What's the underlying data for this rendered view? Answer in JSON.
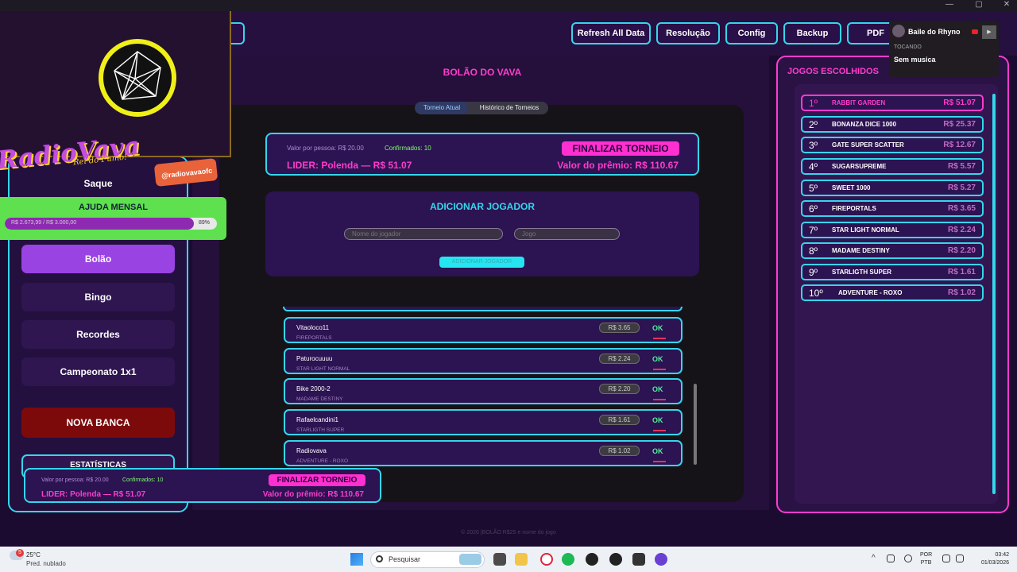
{
  "window_controls": [
    "—",
    "▢",
    "✕"
  ],
  "header": {
    "buttons": [
      "Refresh All Data",
      "Resolução",
      "Config",
      "Backup",
      "PDF"
    ]
  },
  "main": {
    "title": "BOLÃO DO VAVA",
    "tabs": [
      "Torneio Atual",
      "Histórico de Torneios"
    ],
    "summary": {
      "per_person": "Valor por pessoa: R$ 20.00",
      "confirmed": "Confirmados: 10",
      "finalize_label": "FINALIZAR TORNEIO",
      "leader": "LIDER: Polenda — R$ 51.07",
      "prize": "Valor do prêmio: R$ 110.67"
    },
    "add_player": {
      "title": "ADICIONAR JOGADOR",
      "name_placeholder": "Nome do jogador",
      "game_placeholder": "Jogo",
      "button_label": "ADICIONAR JOGADOR"
    },
    "players": [
      {
        "name": "Vitaoloco11",
        "game": "FIREPORTALS",
        "value": "R$ 3.65",
        "status": "OK"
      },
      {
        "name": "Paturocuuuu",
        "game": "STAR LIGHT NORMAL",
        "value": "R$ 2.24",
        "status": "OK"
      },
      {
        "name": "Bike 2000-2",
        "game": "MADAME DESTINY",
        "value": "R$ 2.20",
        "status": "OK"
      },
      {
        "name": "Rafaelcandini1",
        "game": "STARLIGTH SUPER",
        "value": "R$ 1.61",
        "status": "OK"
      },
      {
        "name": "Radiovava",
        "game": "ADVENTURE - ROXO",
        "value": "R$ 1.02",
        "status": "OK"
      }
    ]
  },
  "footer": "© 2026 |BOLÃO R$25 e nome do jogo",
  "right_panel": {
    "title": "JOGOS ESCOLHIDOS",
    "games": [
      {
        "rank": "1º",
        "name": "RABBIT GARDEN",
        "value": "R$ 51.07"
      },
      {
        "rank": "2º",
        "name": "BONANZA DICE 1000",
        "value": "R$ 25.37"
      },
      {
        "rank": "3º",
        "name": "GATE SUPER SCATTER",
        "value": "R$ 12.67"
      },
      {
        "rank": "4º",
        "name": "SUGARSUPREME",
        "value": "R$ 5.57"
      },
      {
        "rank": "5º",
        "name": "SWEET  1000",
        "value": "R$ 5.27"
      },
      {
        "rank": "6º",
        "name": "FIREPORTALS",
        "value": "R$ 3.65"
      },
      {
        "rank": "7º",
        "name": "STAR LIGHT NORMAL",
        "value": "R$ 2.24"
      },
      {
        "rank": "8º",
        "name": "MADAME DESTINY",
        "value": "R$ 2.20"
      },
      {
        "rank": "9º",
        "name": "STARLIGTH SUPER",
        "value": "R$ 1.61"
      },
      {
        "rank": "10º",
        "name": "ADVENTURE - ROXO",
        "value": "R$ 1.02"
      }
    ]
  },
  "sidebar": {
    "saque": "Saque",
    "items": [
      "Bolão",
      "Bingo",
      "Recordes",
      "Campeonato 1x1"
    ],
    "nova_banca": "NOVA BANCA",
    "stats": "ESTATÍSTICAS"
  },
  "help": {
    "title": "AJUDA MENSAL",
    "amount": "R$ 2.673,99 / R$ 3.000,00",
    "percent": "89%",
    "progress": 0.89
  },
  "branding": {
    "name": "RadioVava",
    "tagline": "Rei do Fumo!",
    "handle": "@radiovavaofc"
  },
  "music": {
    "song": "Baile do Rhyno",
    "status": "TOCANDO",
    "track": "Sem musica"
  },
  "taskbar": {
    "weather_temp": "25°C",
    "weather_desc": "Pred. nublado",
    "weather_badge": "5",
    "search_placeholder": "Pesquisar",
    "lang": "POR",
    "lang2": "PTB",
    "time": "03:42",
    "date": "01/03/2026"
  },
  "colors": {
    "accent_cyan": "#35d6ec",
    "accent_pink": "#ff3ccd",
    "ok_green": "#4ef09a",
    "help_green": "#5ee04f",
    "danger_red": "#7d0a0a"
  }
}
